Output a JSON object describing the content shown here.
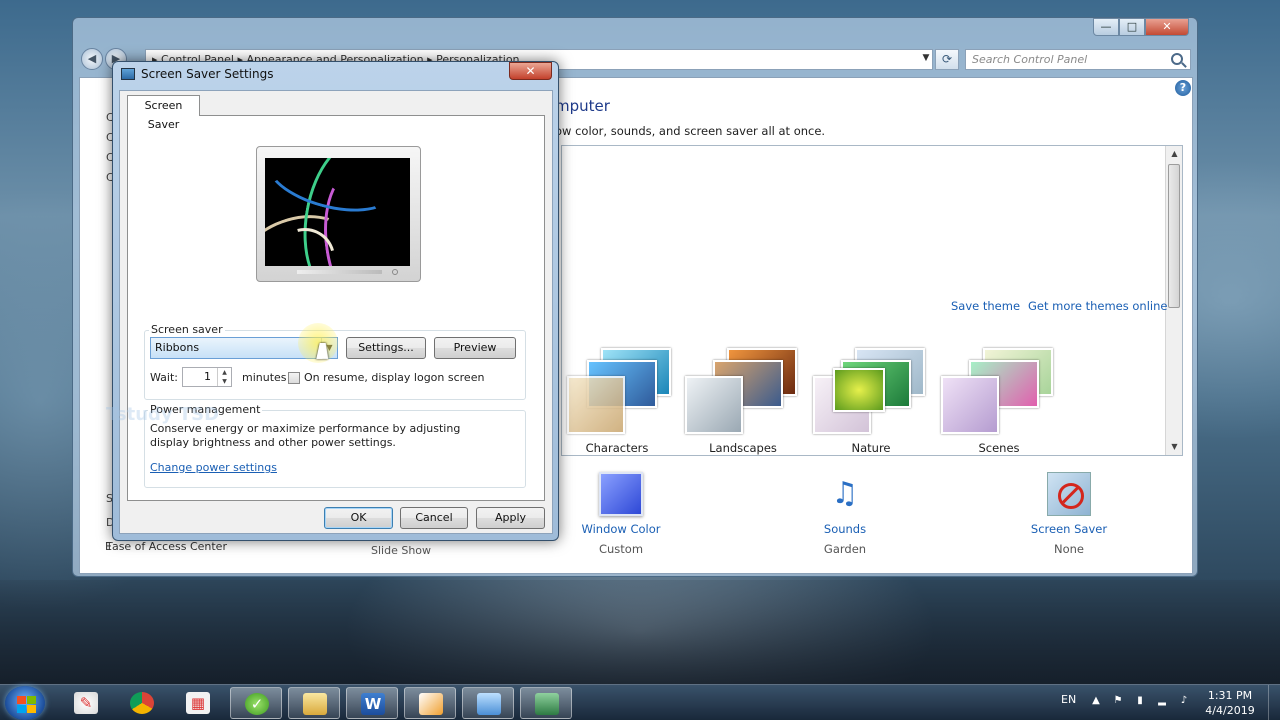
{
  "control_panel": {
    "breadcrumb": "▸ Control Panel ▸ Appearance and Personalization ▸ Personalization",
    "search_placeholder": "Search Control Panel",
    "heading": "mputer",
    "subheading": "ow color, sounds, and screen saver all at once.",
    "side_letters_top": [
      "C",
      "C",
      "C",
      "C"
    ],
    "side_letters_bottom": [
      "S",
      "D",
      "T"
    ],
    "save_theme": "Save theme",
    "more_themes": "Get more themes online",
    "themes": [
      {
        "label": "Characters"
      },
      {
        "label": "Landscapes"
      },
      {
        "label": "Nature"
      },
      {
        "label": "Scenes"
      }
    ],
    "ease_of_access": "Ease of Access Center",
    "slide_show": "Slide Show",
    "bottom_items": [
      {
        "title": "Window Color",
        "subtitle": "Custom"
      },
      {
        "title": "Sounds",
        "subtitle": "Garden"
      },
      {
        "title": "Screen Saver",
        "subtitle": "None"
      }
    ],
    "window_controls": {
      "minimize": "—",
      "maximize": "□",
      "close": "✕"
    }
  },
  "dialog": {
    "title": "Screen Saver Settings",
    "close": "✕",
    "tab": "Screen Saver",
    "screen_saver_group": "Screen saver",
    "selected_screensaver": "Ribbons",
    "settings_button": "Settings...",
    "preview_button": "Preview",
    "wait_label": "Wait:",
    "wait_value": "1",
    "minutes_label": "minutes",
    "logon_checkbox_label": "On resume, display logon screen",
    "logon_checked": false,
    "power_group": "Power management",
    "power_desc": "Conserve energy or maximize performance by adjusting display brightness and other power settings.",
    "power_link": "Change power settings",
    "ok": "OK",
    "cancel": "Cancel",
    "apply": "Apply",
    "watermark": "Tstudy TSD"
  },
  "taskbar": {
    "language": "EN",
    "time": "1:31 PM",
    "date": "4/4/2019",
    "apps": [
      {
        "icon": "paint-icon"
      },
      {
        "icon": "chrome-icon"
      },
      {
        "icon": "app-grid-icon"
      },
      {
        "icon": "green-app-icon"
      },
      {
        "icon": "folder-icon"
      },
      {
        "icon": "word-icon"
      },
      {
        "icon": "tool-icon"
      },
      {
        "icon": "control-panel-icon"
      },
      {
        "icon": "screen-saver-icon"
      }
    ]
  }
}
